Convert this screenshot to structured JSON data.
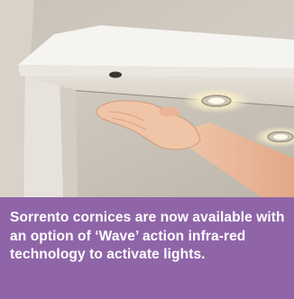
{
  "caption": {
    "text": "Sorrento cornices are now available with an option of ‘Wave’ action infra-red technology to activate lights."
  },
  "colors": {
    "caption_background": "#8f65a8",
    "caption_text": "#ffffff",
    "wall": "#cdc7be",
    "cornice": "#f4f2ee",
    "downlight_glow": "#fff6da"
  },
  "photo_subject": "hand waving beneath illuminated cornice downlights"
}
